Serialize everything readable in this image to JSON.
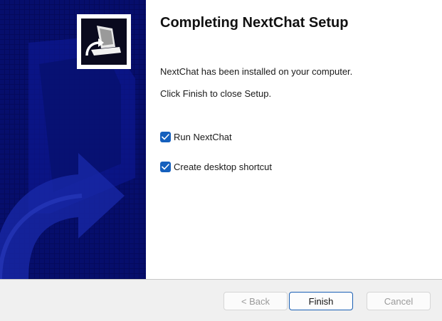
{
  "window": {
    "title": "Completing NextChat Setup"
  },
  "messages": {
    "installed": "NextChat has been installed on your computer.",
    "close_hint": "Click Finish to close Setup."
  },
  "options": [
    {
      "label": "Run NextChat",
      "checked": true
    },
    {
      "label": "Create desktop shortcut",
      "checked": true
    }
  ],
  "buttons": {
    "back": "< Back",
    "finish": "Finish",
    "cancel": "Cancel"
  },
  "colors": {
    "banner": "#050a5c",
    "banner_accent": "#1a2a9e",
    "checkbox": "#1560bd",
    "finish_border": "#1a5fb4"
  },
  "icons": {
    "logo": "installer-computer-icon",
    "checkbox": "checkmark-icon"
  }
}
